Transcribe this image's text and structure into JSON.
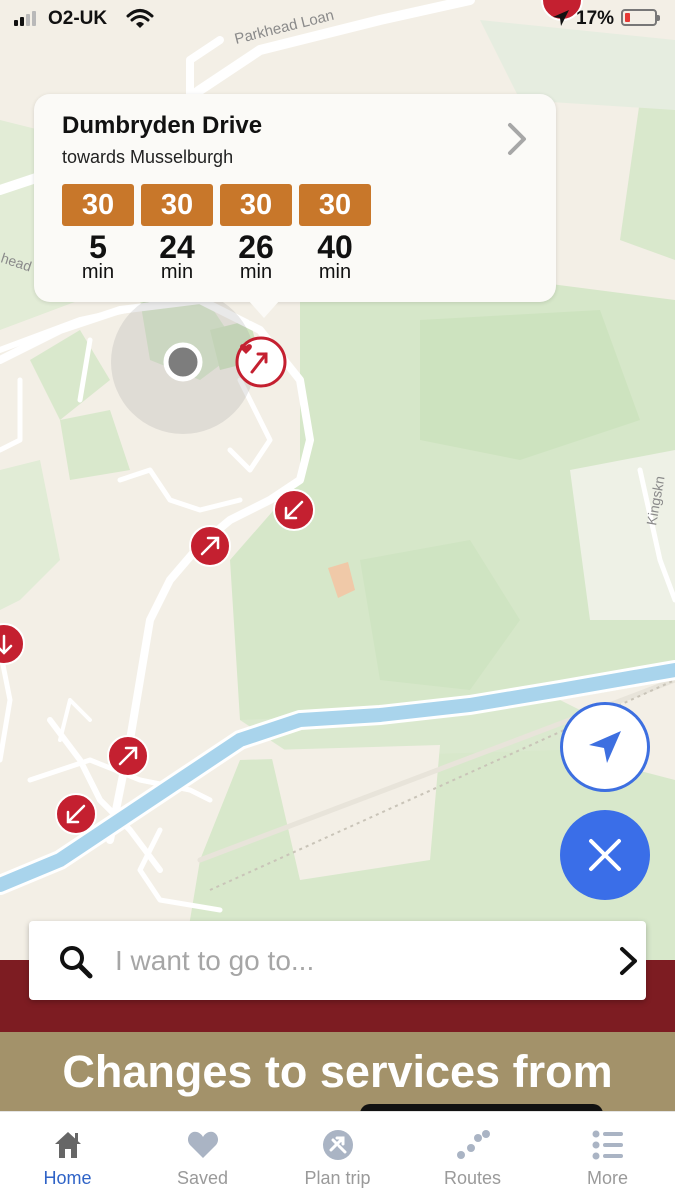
{
  "status_bar": {
    "carrier": "O2-UK",
    "battery_percent": "17%"
  },
  "map": {
    "road_labels": [
      "Parkhead Loan",
      "Kingskn",
      "head"
    ],
    "colors": {
      "land": "#f3efe6",
      "park": "#d8e8cc",
      "river": "#a9d4ec",
      "stop_marker": "#c42030"
    }
  },
  "stop_card": {
    "name": "Dumbryden Drive",
    "direction": "towards Musselburgh",
    "departures": [
      {
        "route": "30",
        "due": "5",
        "unit": "min"
      },
      {
        "route": "30",
        "due": "24",
        "unit": "min"
      },
      {
        "route": "30",
        "due": "26",
        "unit": "min"
      },
      {
        "route": "30",
        "due": "40",
        "unit": "min"
      }
    ],
    "route_color": "#c8772a"
  },
  "search": {
    "placeholder": "I want to go to..."
  },
  "banner": {
    "title": "Changes to services from"
  },
  "tab_bar": {
    "active": "Home",
    "items": [
      {
        "label": "Home",
        "icon": "home-icon"
      },
      {
        "label": "Saved",
        "icon": "heart-icon"
      },
      {
        "label": "Plan trip",
        "icon": "plan-trip-icon"
      },
      {
        "label": "Routes",
        "icon": "routes-icon"
      },
      {
        "label": "More",
        "icon": "list-icon"
      }
    ],
    "active_color": "#2f63c7"
  }
}
